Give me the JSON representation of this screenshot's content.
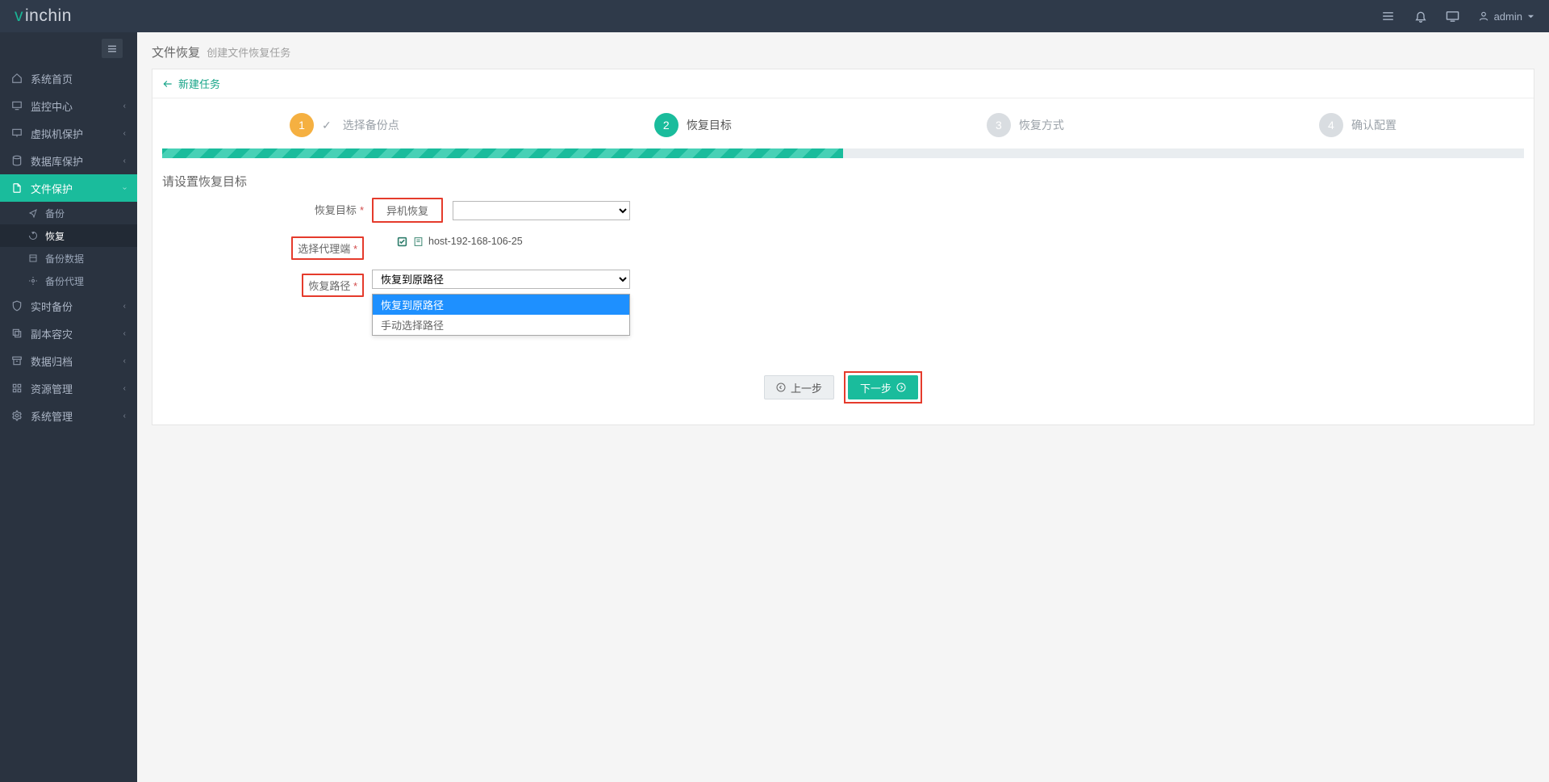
{
  "brand": {
    "prefix": "v",
    "rest": "inchin"
  },
  "topbar": {
    "user": "admin"
  },
  "sidebar": {
    "items": [
      {
        "label": "系统首页",
        "icon": "home"
      },
      {
        "label": "监控中心",
        "icon": "monitor",
        "expandable": true
      },
      {
        "label": "虚拟机保护",
        "icon": "vm",
        "expandable": true
      },
      {
        "label": "数据库保护",
        "icon": "db",
        "expandable": true
      },
      {
        "label": "文件保护",
        "icon": "file",
        "expandable": true,
        "active": true
      },
      {
        "label": "实时备份",
        "icon": "shield",
        "expandable": true
      },
      {
        "label": "副本容灾",
        "icon": "copy",
        "expandable": true
      },
      {
        "label": "数据归档",
        "icon": "archive",
        "expandable": true
      },
      {
        "label": "资源管理",
        "icon": "resource",
        "expandable": true
      },
      {
        "label": "系统管理",
        "icon": "gear",
        "expandable": true
      }
    ],
    "fileSub": [
      {
        "label": "备份",
        "icon": "share"
      },
      {
        "label": "恢复",
        "icon": "restore",
        "current": true
      },
      {
        "label": "备份数据",
        "icon": "data"
      },
      {
        "label": "备份代理",
        "icon": "agent"
      }
    ]
  },
  "breadcrumb": {
    "title": "文件恢复",
    "sub": "创建文件恢复任务"
  },
  "wizard": {
    "newTask": "新建任务",
    "steps": [
      {
        "n": "1",
        "label": "选择备份点",
        "state": "done"
      },
      {
        "n": "2",
        "label": "恢复目标",
        "state": "active"
      },
      {
        "n": "3",
        "label": "恢复方式",
        "state": ""
      },
      {
        "n": "4",
        "label": "确认配置",
        "state": ""
      }
    ]
  },
  "form": {
    "sectionTitle": "请设置恢复目标",
    "rows": {
      "target": {
        "label": "恢复目标",
        "value": "异机恢复"
      },
      "agent": {
        "label": "选择代理端",
        "value": "host-192-168-106-25"
      },
      "path": {
        "label": "恢复路径",
        "value": "恢复到原路径"
      }
    },
    "pathOptions": [
      "恢复到原路径",
      "手动选择路径"
    ]
  },
  "buttons": {
    "prev": "上一步",
    "next": "下一步"
  }
}
